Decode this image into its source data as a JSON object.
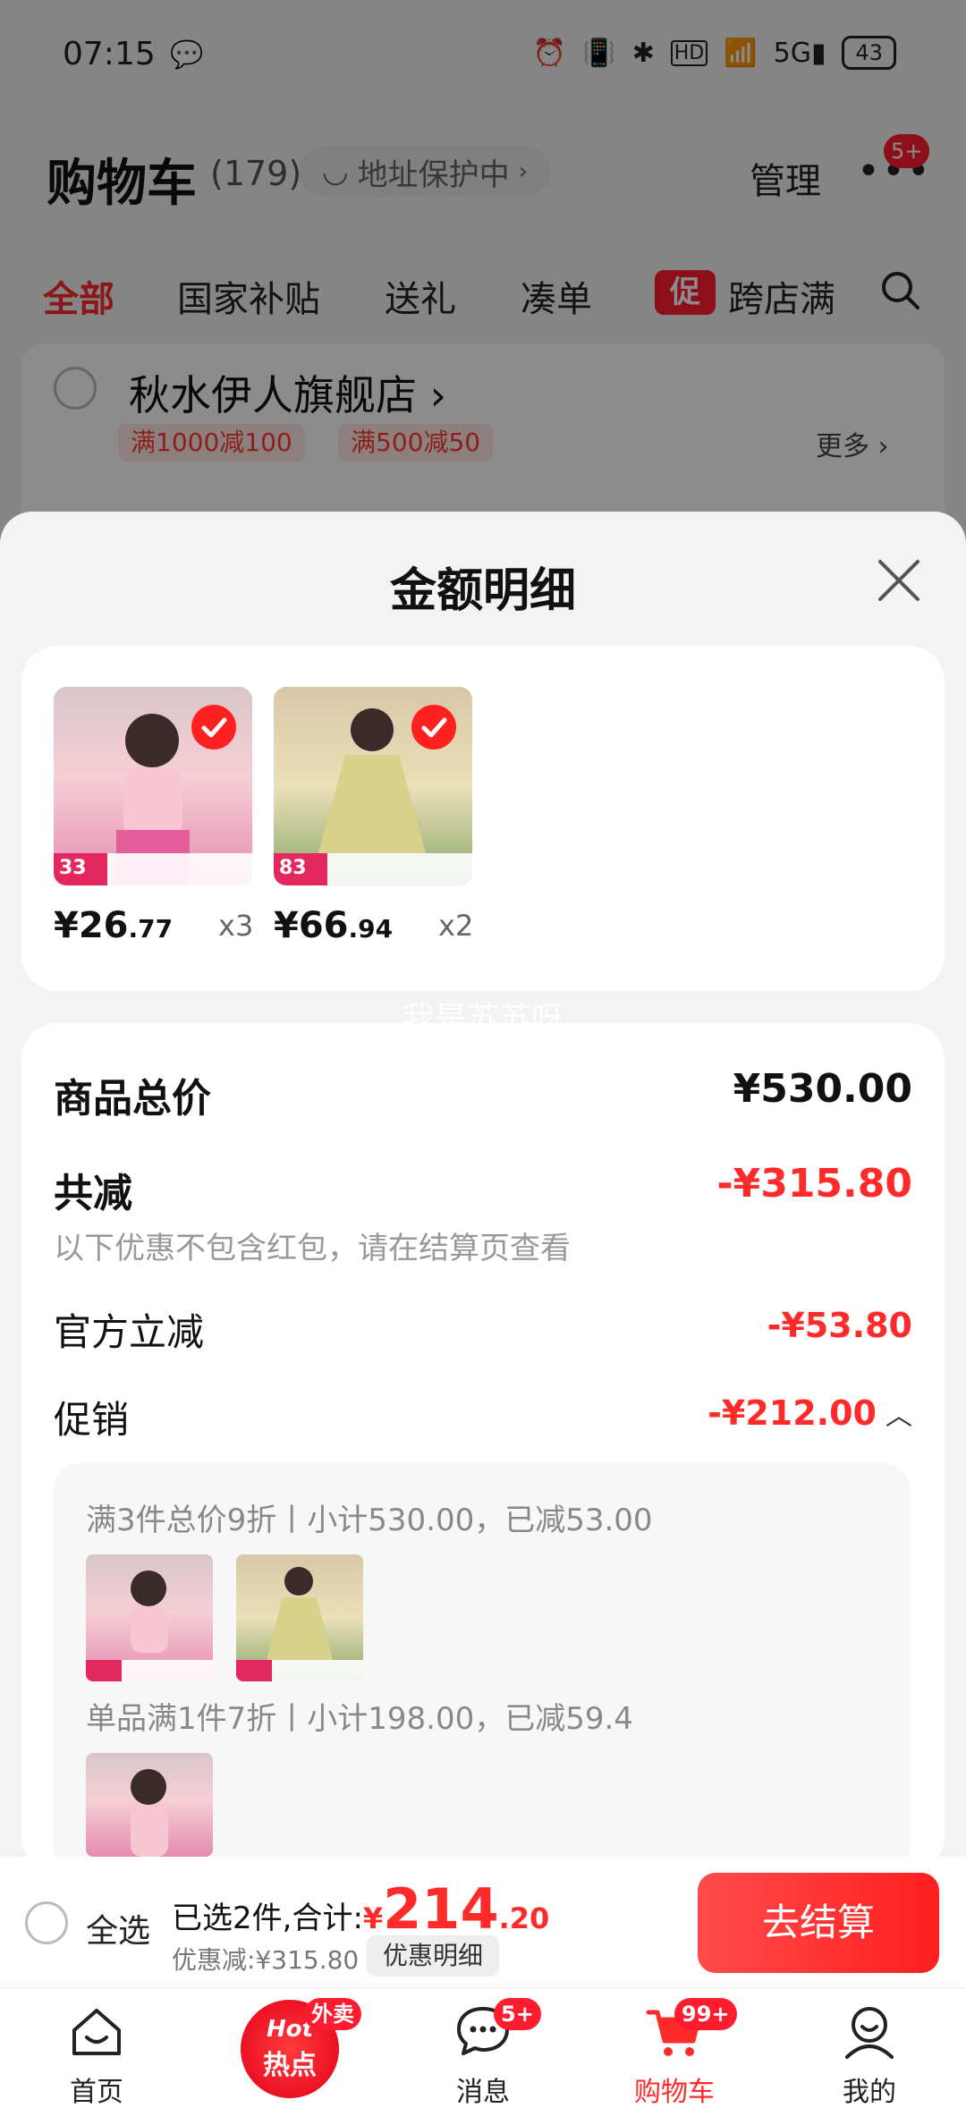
{
  "status_bar": {
    "time": "07:15",
    "battery": "43"
  },
  "header": {
    "title": "购物车",
    "count": "(179)",
    "address": "地址保护中",
    "manage": "管理",
    "more_badge": "5+"
  },
  "tabs": [
    {
      "label": "全部",
      "active": true
    },
    {
      "label": "国家补贴",
      "active": false
    },
    {
      "label": "送礼",
      "active": false
    },
    {
      "label": "凑单",
      "active": false
    },
    {
      "label": "跨店满",
      "active": false
    }
  ],
  "promo_badge": "促",
  "store": {
    "name": "秋水伊人旗舰店",
    "promo1": "满1000减100",
    "promo2": "满500减50",
    "more": "更多"
  },
  "sheet": {
    "title": "金额明细"
  },
  "products": [
    {
      "price_int": "¥26",
      "price_dec": ".77",
      "qty": "x3",
      "badge_num": "33"
    },
    {
      "price_int": "¥66",
      "price_dec": ".94",
      "qty": "x2",
      "badge_num": "83"
    }
  ],
  "watermark": "我是苏苏呀",
  "detail": {
    "total_label": "商品总价",
    "total_value": "¥530.00",
    "reduce_label": "共减",
    "reduce_value": "-¥315.80",
    "reduce_hint": "以下优惠不包含红包，请在结算页查看",
    "official_label": "官方立减",
    "official_value": "-¥53.80",
    "promo_label": "促销",
    "promo_value": "-¥212.00",
    "promo_line1": "满3件总价9折丨小计530.00，已减53.00",
    "promo_line2": "单品满1件7折丨小计198.00，已减59.4"
  },
  "checkout": {
    "select_all": "全选",
    "selected_prefix": "已选2件,合计:",
    "currency": "¥",
    "amount_int": "214",
    "amount_dec": ".20",
    "discount": "优惠减:¥315.80",
    "discount_btn": "优惠明细",
    "button": "去结算"
  },
  "nav": [
    {
      "label": "首页",
      "badge": ""
    },
    {
      "label": "",
      "badge": "外卖",
      "hot_text": "Hot",
      "hot_sub": "热点"
    },
    {
      "label": "消息",
      "badge": "5+"
    },
    {
      "label": "购物车",
      "badge": "99+",
      "active": true
    },
    {
      "label": "我的",
      "badge": ""
    }
  ],
  "colors": {
    "accent": "#ff2b2b",
    "sheet_bg": "#f3f3f3"
  }
}
